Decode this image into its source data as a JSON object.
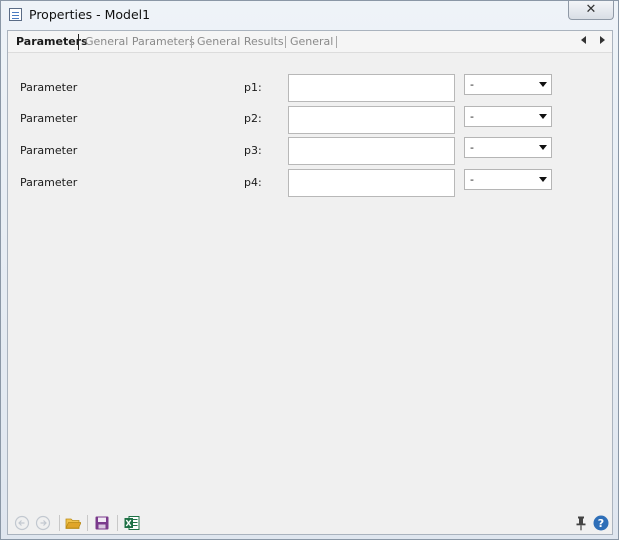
{
  "window": {
    "title": "Properties - Model1",
    "close_glyph": "✕"
  },
  "tabs": [
    {
      "label": "Parameters",
      "active": true
    },
    {
      "label": "General Parameters",
      "active": false
    },
    {
      "label": "General Results",
      "active": false
    },
    {
      "label": "General",
      "active": false
    }
  ],
  "parameters": [
    {
      "label": "Parameter",
      "name": "p1:",
      "value": "",
      "unit": "-"
    },
    {
      "label": "Parameter",
      "name": "p2:",
      "value": "",
      "unit": "-"
    },
    {
      "label": "Parameter",
      "name": "p3:",
      "value": "",
      "unit": "-"
    },
    {
      "label": "Parameter",
      "name": "p4:",
      "value": "",
      "unit": "-"
    }
  ],
  "toolbar": {
    "icons": [
      "back-icon",
      "forward-icon",
      "open-folder-icon",
      "save-icon",
      "excel-icon",
      "pin-icon",
      "help-icon"
    ],
    "help_glyph": "?"
  },
  "colors": {
    "accent": "#2f6fb8",
    "excel": "#1e7145",
    "save": "#7a3a8c",
    "folder": "#e0a528"
  }
}
